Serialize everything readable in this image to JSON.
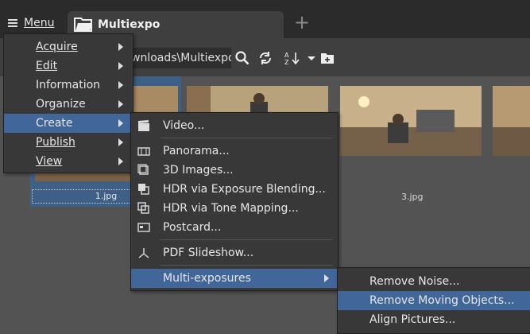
{
  "app": {
    "menu_label": "Menu",
    "tab_title": "Multiexpo",
    "path_text": "wnloads\\Multiexpo"
  },
  "thumbnails": [
    {
      "label": "1.jpg"
    },
    {
      "label": ""
    },
    {
      "label": "3.jpg"
    },
    {
      "label": ""
    }
  ],
  "main_menu": {
    "items": [
      {
        "label": "Acquire",
        "has_submenu": true
      },
      {
        "label": "Edit",
        "has_submenu": true
      },
      {
        "label": "Information",
        "has_submenu": true
      },
      {
        "label": "Organize",
        "has_submenu": true
      },
      {
        "label": "Create",
        "has_submenu": true,
        "highlighted": true
      },
      {
        "label": "Publish",
        "has_submenu": true
      },
      {
        "label": "View",
        "has_submenu": true
      }
    ]
  },
  "create_menu": {
    "items": [
      {
        "label": "Video...",
        "icon": "video-icon"
      },
      {
        "label": "Panorama...",
        "icon": "panorama-icon"
      },
      {
        "label": "3D Images...",
        "icon": "3d-images-icon"
      },
      {
        "label": "HDR via Exposure Blending...",
        "icon": "hdr-icon"
      },
      {
        "label": "HDR via Tone Mapping...",
        "icon": "hdr-tone-icon"
      },
      {
        "label": "Postcard...",
        "icon": "postcard-icon"
      },
      {
        "label": "PDF Slideshow...",
        "icon": "pdf-icon"
      },
      {
        "label": "Multi-exposures",
        "icon": "",
        "highlighted": true
      }
    ]
  },
  "multiexposure_menu": {
    "items": [
      {
        "label": "Remove Noise..."
      },
      {
        "label": "Remove Moving Objects...",
        "highlighted": true
      },
      {
        "label": "Align Pictures..."
      }
    ]
  },
  "colors": {
    "highlight": "#41679a",
    "menu_bg": "#383838",
    "titlebar_bg": "#2b2b2b",
    "toolbar_bg": "#3f3f3f",
    "content_bg": "#535353",
    "selection": "#3e5f86"
  }
}
